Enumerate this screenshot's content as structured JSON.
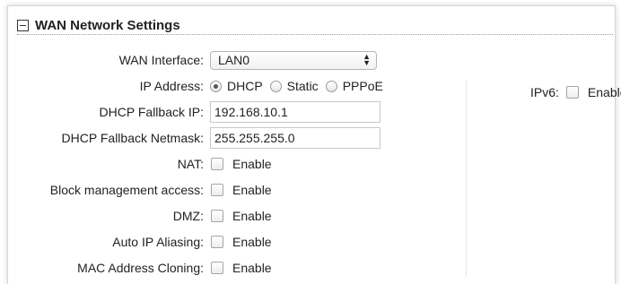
{
  "section": {
    "title": "WAN Network Settings"
  },
  "wan_interface": {
    "label": "WAN Interface:",
    "value": "LAN0"
  },
  "ip_address": {
    "label": "IP Address:",
    "options": [
      {
        "label": "DHCP",
        "selected": true
      },
      {
        "label": "Static",
        "selected": false
      },
      {
        "label": "PPPoE",
        "selected": false
      }
    ]
  },
  "dhcp_fallback_ip": {
    "label": "DHCP Fallback IP:",
    "value": "192.168.10.1"
  },
  "dhcp_fallback_netmask": {
    "label": "DHCP Fallback Netmask:",
    "value": "255.255.255.0"
  },
  "nat": {
    "label": "NAT:",
    "checkbox_label": "Enable",
    "checked": false
  },
  "block_management": {
    "label": "Block management access:",
    "checkbox_label": "Enable",
    "checked": false
  },
  "dmz": {
    "label": "DMZ:",
    "checkbox_label": "Enable",
    "checked": false
  },
  "auto_ip_aliasing": {
    "label": "Auto IP Aliasing:",
    "checkbox_label": "Enable",
    "checked": false
  },
  "mac_cloning": {
    "label": "MAC Address Cloning:",
    "checkbox_label": "Enable",
    "checked": false
  },
  "ipv6": {
    "label": "IPv6:",
    "checkbox_label": "Enable",
    "checked": false
  }
}
